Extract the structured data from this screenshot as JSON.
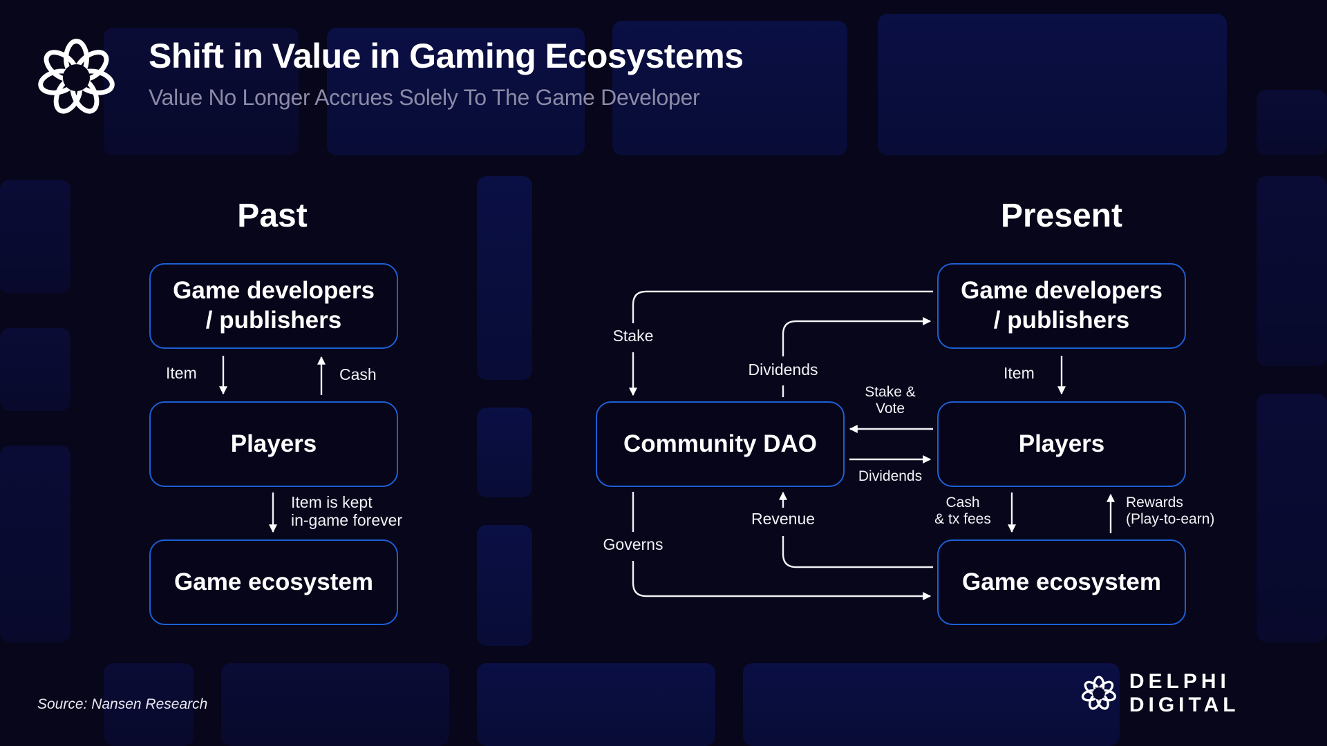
{
  "header": {
    "title": "Shift in Value in Gaming Ecosystems",
    "subtitle": "Value No Longer Accrues Solely To The Game Developer",
    "logo_icon": "delphi-knot-icon"
  },
  "past": {
    "heading": "Past",
    "nodes": {
      "developers": "Game developers / publishers",
      "players": "Players",
      "ecosystem": "Game ecosystem"
    },
    "edges": {
      "item": "Item",
      "cash": "Cash",
      "item_kept_line1": "Item is kept",
      "item_kept_line2": "in-game forever"
    }
  },
  "present": {
    "heading": "Present",
    "nodes": {
      "developers": "Game developers / publishers",
      "dao": "Community DAO",
      "players": "Players",
      "ecosystem": "Game ecosystem"
    },
    "edges": {
      "stake": "Stake",
      "dividends_dev": "Dividends",
      "item": "Item",
      "stake_vote_line1": "Stake &",
      "stake_vote_line2": "Vote",
      "dividends_players": "Dividends",
      "revenue": "Revenue",
      "governs": "Governs",
      "cash_line1": "Cash",
      "cash_line2": "& tx fees",
      "rewards_line1": "Rewards",
      "rewards_line2": "(Play-to-earn)"
    }
  },
  "footer": {
    "source": "Source: Nansen Research",
    "brand": "DELPHI DIGITAL",
    "brand_icon": "delphi-knot-icon"
  },
  "colors": {
    "background": "#07061a",
    "node_border": "#1d5fd6",
    "tile": "#0a0f44",
    "subtitle": "#8c8aa6"
  }
}
